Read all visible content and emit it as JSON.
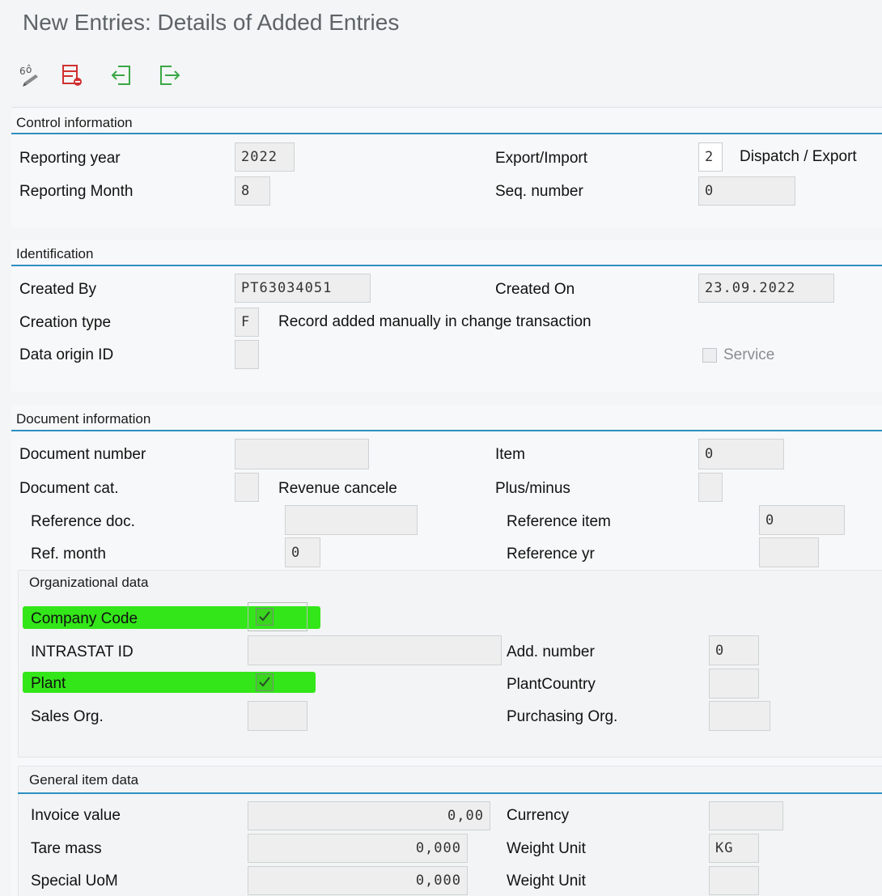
{
  "window": {
    "title": "New Entries: Details of Added Entries"
  },
  "toolbar": {
    "icons": [
      "glasses-change-icon",
      "delete-row-icon",
      "previous-entry-icon",
      "next-entry-icon"
    ]
  },
  "control_information": {
    "title": "Control information",
    "reporting_year": {
      "label": "Reporting year",
      "value": "2022"
    },
    "reporting_month": {
      "label": "Reporting Month",
      "value": "8"
    },
    "export_import": {
      "label": "Export/Import",
      "value": "2",
      "text": "Dispatch / Export"
    },
    "seq_number": {
      "label": "Seq. number",
      "value": "0"
    }
  },
  "identification": {
    "title": "Identification",
    "created_by": {
      "label": "Created By",
      "value": "PT63034051"
    },
    "created_on": {
      "label": "Created On",
      "value": "23.09.2022"
    },
    "creation_type": {
      "label": "Creation type",
      "value": "F",
      "text": "Record added manually in change transaction"
    },
    "data_origin_id": {
      "label": "Data origin ID",
      "value": ""
    },
    "service": {
      "label": "Service",
      "checked": false
    }
  },
  "document_information": {
    "title": "Document information",
    "document_number": {
      "label": "Document number",
      "value": ""
    },
    "item": {
      "label": "Item",
      "value": "0"
    },
    "document_cat": {
      "label": "Document cat.",
      "value": "",
      "text": "Revenue cancele"
    },
    "plus_minus": {
      "label": "Plus/minus",
      "value": ""
    },
    "reference_doc": {
      "label": "Reference doc.",
      "value": ""
    },
    "reference_item": {
      "label": "Reference item",
      "value": "0"
    },
    "ref_month": {
      "label": "Ref. month",
      "value": "0"
    },
    "reference_yr": {
      "label": "Reference yr",
      "value": ""
    }
  },
  "organizational_data": {
    "title": "Organizational data",
    "company_code": {
      "label": "Company Code",
      "checked": true
    },
    "intrastat_id": {
      "label": "INTRASTAT ID",
      "value": ""
    },
    "add_number": {
      "label": "Add. number",
      "value": "0"
    },
    "plant": {
      "label": "Plant",
      "checked": true
    },
    "plant_country": {
      "label": "PlantCountry",
      "value": ""
    },
    "sales_org": {
      "label": "Sales Org.",
      "value": ""
    },
    "purchasing_org": {
      "label": "Purchasing Org.",
      "value": ""
    }
  },
  "general_item_data": {
    "title": "General item data",
    "invoice_value": {
      "label": "Invoice value",
      "value": "0,00"
    },
    "currency": {
      "label": "Currency",
      "value": ""
    },
    "tare_mass": {
      "label": "Tare mass",
      "value": "0,000"
    },
    "weight_unit_1": {
      "label": "Weight Unit",
      "value": "KG"
    },
    "special_uom": {
      "label": "Special UoM",
      "value": "0,000"
    },
    "weight_unit_2": {
      "label": "Weight Unit",
      "value": ""
    }
  },
  "colors": {
    "section_line": "#2d8fc1",
    "highlight": "#33e619",
    "field_bg": "#eeeeee"
  }
}
